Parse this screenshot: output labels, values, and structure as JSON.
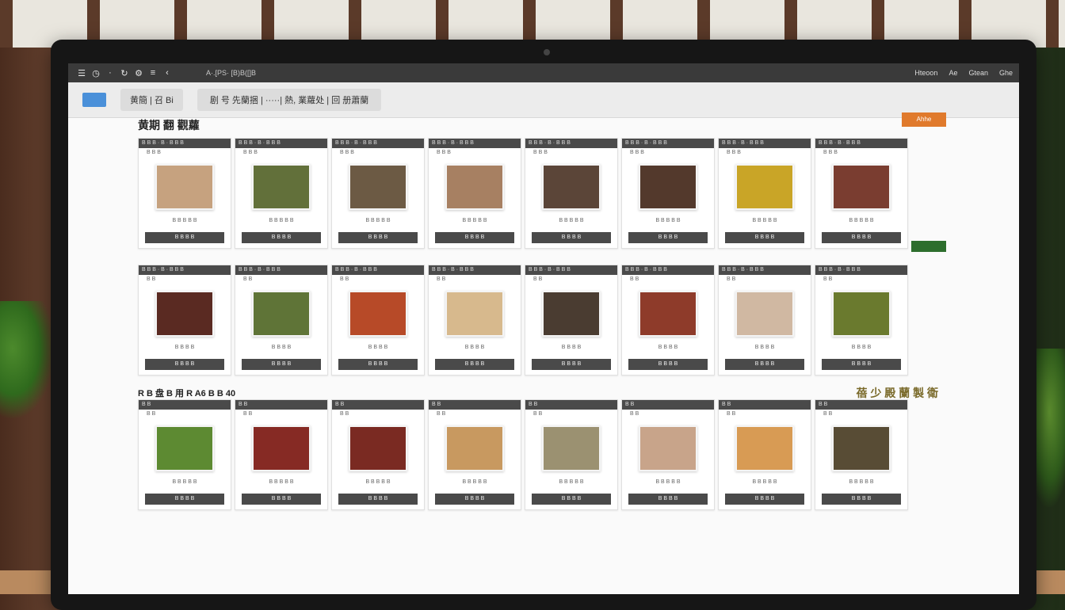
{
  "topbar": {
    "icons": [
      "menu-icon",
      "clock-icon",
      "dot-icon",
      "refresh-icon",
      "settings-icon",
      "list-icon",
      "chevron-icon"
    ],
    "left_text": "A·.[PS·  [B)B([]B",
    "right_items": [
      "Hteoon",
      "Ae",
      "Gtean",
      "Ghe"
    ]
  },
  "toolbar": {
    "group1": "黄簡 | 召 Bi",
    "group2": "剧  号 先蘭捆 |  ·····|  熱, 業蘿处 |  回 册蕭蘭"
  },
  "page": {
    "title": "黄期 翻 觀蘿",
    "action_label": "Ahhe"
  },
  "rows": [
    {
      "title": "",
      "accent": "",
      "cards": [
        {
          "header": "B  B  B · B · B B  B",
          "sub": "B  B  B",
          "color": "#c6a27f",
          "caption": "B  B  B  B  B",
          "price": "B  B  B  B"
        },
        {
          "header": "B  B  B · B · B B  B",
          "sub": "B  B  B",
          "color": "#62703a",
          "caption": "B  B  B  B  B",
          "price": "B  B  B  B"
        },
        {
          "header": "B  B  B · B · B B  B",
          "sub": "B  B  B",
          "color": "#6c5a44",
          "caption": "B  B  B  B  B",
          "price": "B  B  B  B"
        },
        {
          "header": "B  B  B · B · B B  B",
          "sub": "B  B  B",
          "color": "#a78062",
          "caption": "B  B  B  B  B",
          "price": "B  B  B  B"
        },
        {
          "header": "B  B  B · B · B B  B",
          "sub": "B  B  B",
          "color": "#5b4538",
          "caption": "B  B  B  B  B",
          "price": "B  B  B  B"
        },
        {
          "header": "B  B  B · B · B B  B",
          "sub": "B  B  B",
          "color": "#53392c",
          "caption": "B  B  B  B  B",
          "price": "B  B  B  B"
        },
        {
          "header": "B  B  B · B · B B  B",
          "sub": "B  B  B",
          "color": "#c9a527",
          "caption": "B  B  B  B  B",
          "price": "B  B  B  B"
        },
        {
          "header": "B  B  B · B · B B  B",
          "sub": "B  B  B",
          "color": "#7a3d30",
          "caption": "B  B  B  B  B",
          "price": "B  B  B  B"
        }
      ]
    },
    {
      "title": "",
      "accent": "",
      "cards": [
        {
          "header": "B B B · B · B B B",
          "sub": "B  B",
          "color": "#5a2a22",
          "caption": "B  B  B  B",
          "price": "B  B  B  B"
        },
        {
          "header": "B B B · B · B B B",
          "sub": "B  B",
          "color": "#5f7437",
          "caption": "B  B  B  B",
          "price": "B  B  B  B"
        },
        {
          "header": "B B B · B · B B B",
          "sub": "B  B",
          "color": "#b74a28",
          "caption": "B  B  B  B",
          "price": "B  B  B  B"
        },
        {
          "header": "B B B · B · B B B",
          "sub": "B  B",
          "color": "#d7b98d",
          "caption": "B  B  B  B",
          "price": "B  B  B  B"
        },
        {
          "header": "B B B · B · B B B",
          "sub": "B  B",
          "color": "#4a3c31",
          "caption": "B  B  B  B",
          "price": "B  B  B  B"
        },
        {
          "header": "B B B · B · B B B",
          "sub": "B  B",
          "color": "#8e3b2a",
          "caption": "B  B  B  B",
          "price": "B  B  B  B"
        },
        {
          "header": "B B B · B · B B B",
          "sub": "B  B",
          "color": "#d0b8a2",
          "caption": "B  B  B  B",
          "price": "B  B  B  B"
        },
        {
          "header": "B B B · B · B B B",
          "sub": "B  B",
          "color": "#6a7a2e",
          "caption": "B  B  B  B",
          "price": "B  B  B  B"
        }
      ]
    },
    {
      "title": "R B 盘 B 用 R  A6 B  B 40",
      "accent": "蓓 少 殿 蘭 製 衛",
      "cards": [
        {
          "header": "B  B",
          "sub": "B  B",
          "color": "#5d8a32",
          "caption": "B  B  B  B  B",
          "price": "B  B  B  B"
        },
        {
          "header": "B  B",
          "sub": "B  B",
          "color": "#862a24",
          "caption": "B  B  B  B  B",
          "price": "B  B  B  B"
        },
        {
          "header": "B  B",
          "sub": "B  B",
          "color": "#7a2a22",
          "caption": "B  B  B  B  B",
          "price": "B  B  B  B"
        },
        {
          "header": "B  B",
          "sub": "B  B",
          "color": "#c89960",
          "caption": "B  B  B  B  B",
          "price": "B  B  B  B"
        },
        {
          "header": "B  B",
          "sub": "B  B",
          "color": "#9b9171",
          "caption": "B  B  B  B  B",
          "price": "B  B  B  B"
        },
        {
          "header": "B  B",
          "sub": "B  B",
          "color": "#c8a48a",
          "caption": "B  B  B  B  B",
          "price": "B  B  B  B"
        },
        {
          "header": "B  B",
          "sub": "B  B",
          "color": "#d89b54",
          "caption": "B  B  B  B  B",
          "price": "B  B  B  B"
        },
        {
          "header": "B  B",
          "sub": "B  B",
          "color": "#584c35",
          "caption": "B  B  B  B  B",
          "price": "B  B  B  B"
        }
      ]
    }
  ]
}
